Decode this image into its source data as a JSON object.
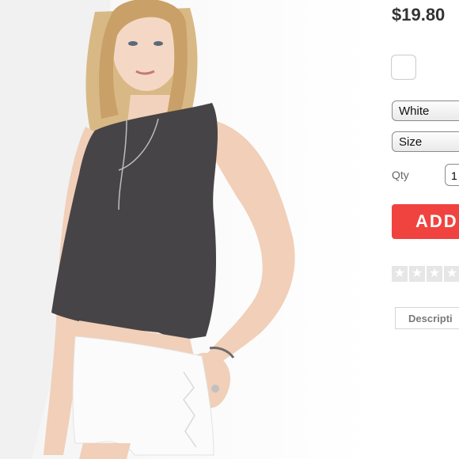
{
  "product": {
    "price": "$19.80",
    "image_alt_icon": "product-photo-model",
    "color_swatch_hex": "#ffffff",
    "color_select_value": "White",
    "size_select_value": "Size",
    "qty_label": "Qty",
    "qty_value": "1",
    "add_button_label": "ADD",
    "rating": {
      "filled": 0,
      "max": 5,
      "empty_star_color": "#e6e6e6"
    },
    "tab_description_label": "Descripti"
  },
  "colors": {
    "accent": "#f0433f",
    "price_text": "#333333"
  }
}
